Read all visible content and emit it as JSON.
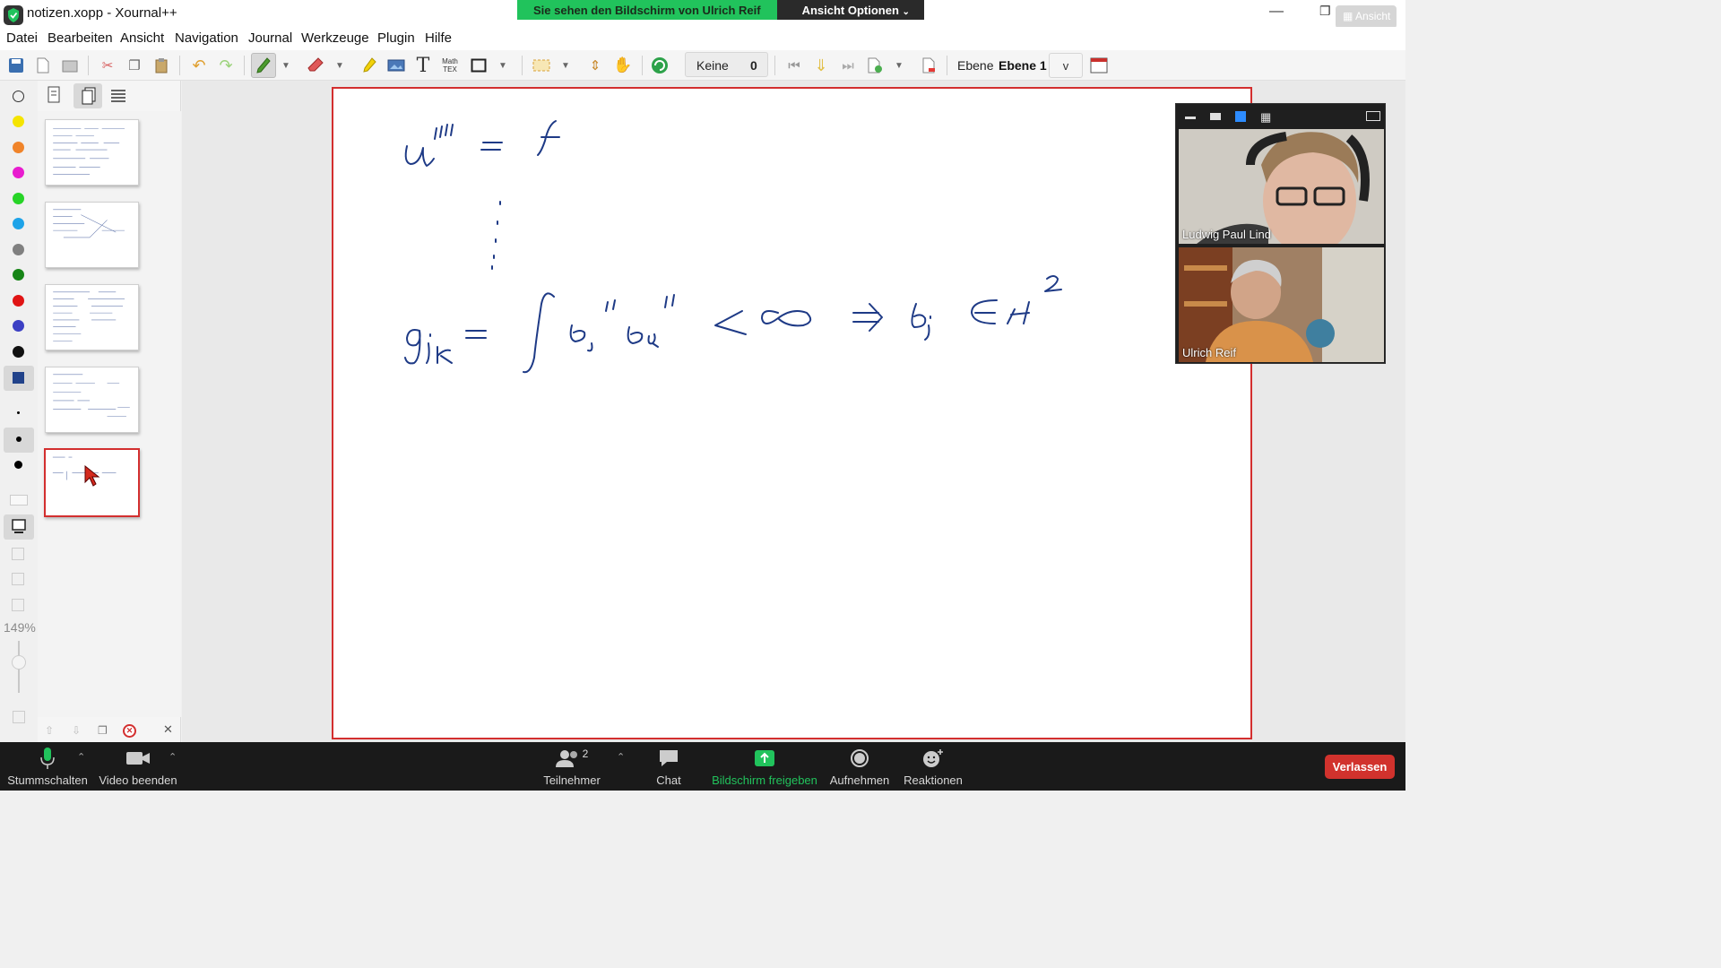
{
  "window": {
    "title": "notizen.xopp - Xournal++",
    "controls": [
      "minimize-icon",
      "restore-icon",
      "close-icon"
    ]
  },
  "share_banner": {
    "text": "Sie sehen den Bildschirm von Ulrich Reif",
    "options_label": "Ansicht Optionen",
    "view_label": "Ansicht"
  },
  "menu": {
    "items": [
      "Datei",
      "Bearbeiten",
      "Ansicht",
      "Navigation",
      "Journal",
      "Werkzeuge",
      "Plugin",
      "Hilfe"
    ]
  },
  "toolbar": {
    "page_select": "Keine",
    "page_number": "0",
    "layer_label": "Ebene",
    "layer_value": "Ebene 1",
    "layer_dropdown": "v",
    "tex_label_top": "Math",
    "tex_label_bottom": "TEX"
  },
  "colors": {
    "palette": [
      "#ffffff",
      "#f5e400",
      "#f0842a",
      "#e81ccf",
      "#27d427",
      "#1ea3e8",
      "#808080",
      "#178517",
      "#e01414",
      "#3c40c4",
      "#111111",
      "#21428a"
    ],
    "ink": "#1e3a86",
    "accent_red": "#d32f2f",
    "zoom_green": "#21c35c"
  },
  "zoom": {
    "level": "149%"
  },
  "sidebar": {
    "page_count": 5,
    "current_page": 5
  },
  "participants": [
    {
      "name": "Ludwig Paul Lind"
    },
    {
      "name": "Ulrich Reif"
    }
  ],
  "meeting_bar": {
    "mute_label": "Stummschalten",
    "video_label": "Video beenden",
    "participants_label": "Teilnehmer",
    "participants_count": "2",
    "chat_label": "Chat",
    "share_label": "Bildschirm freigeben",
    "record_label": "Aufnehmen",
    "reactions_label": "Reaktionen",
    "leave_label": "Verlassen"
  }
}
